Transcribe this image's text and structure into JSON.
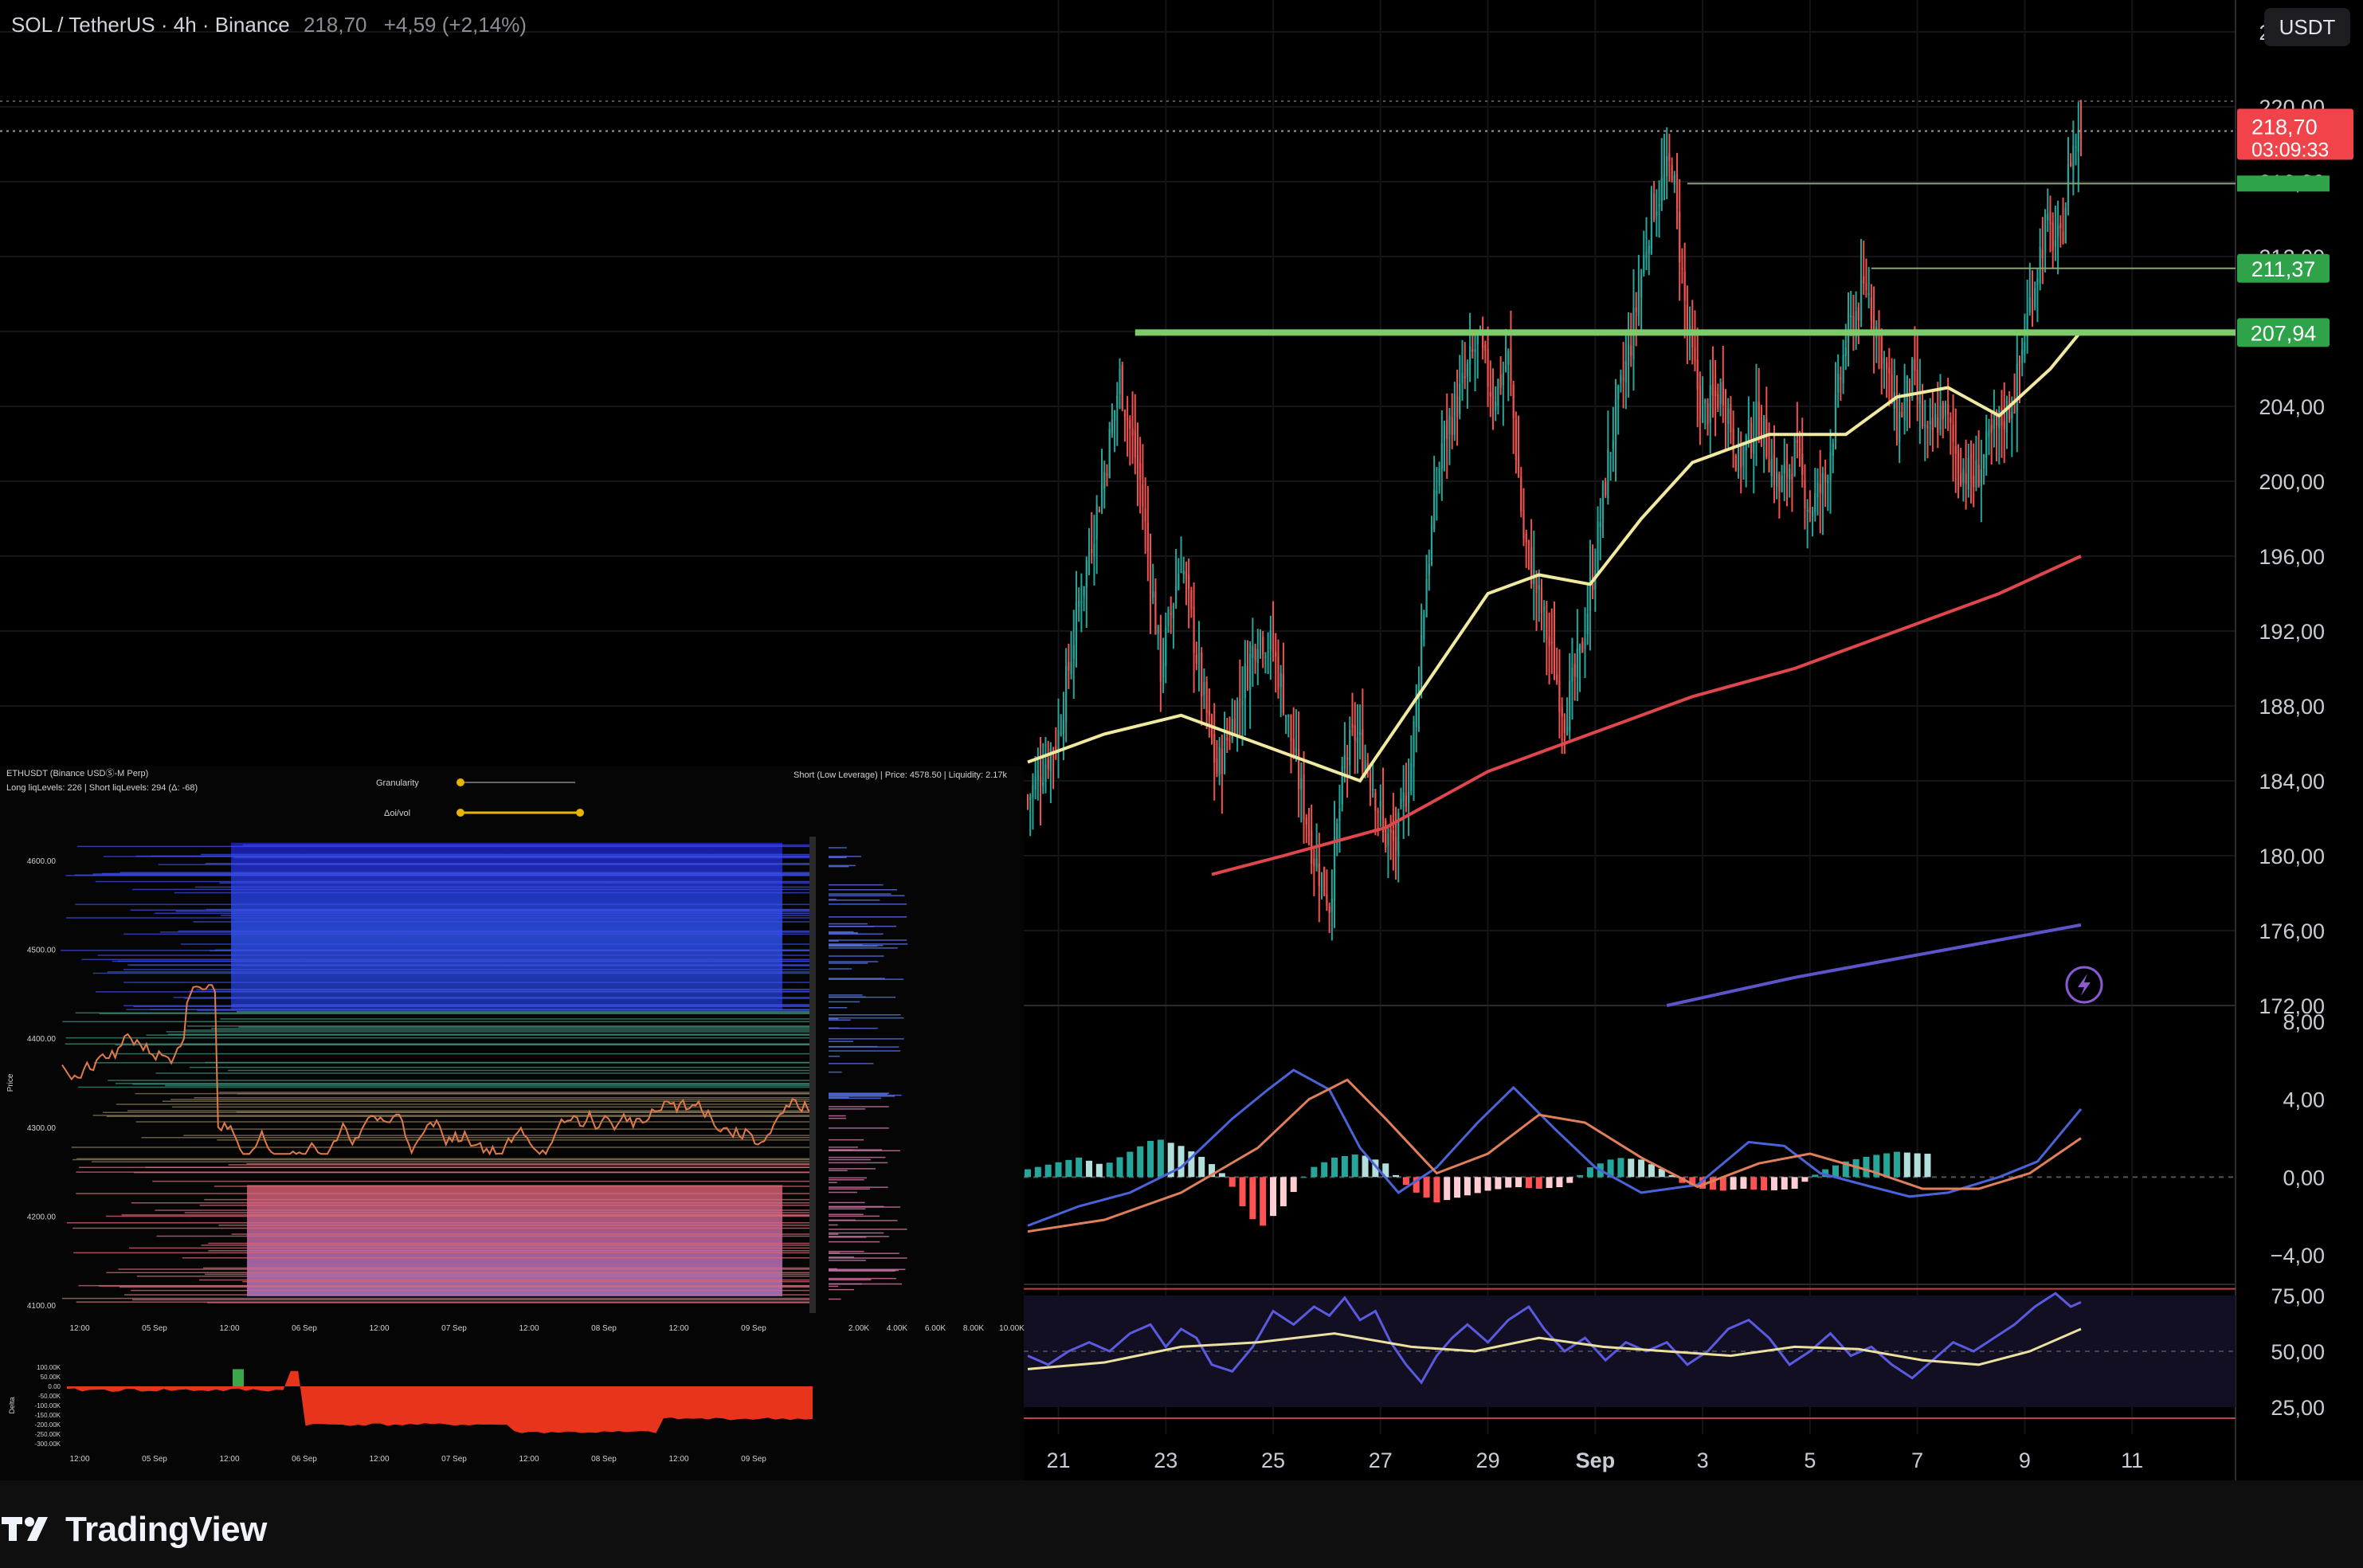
{
  "header": {
    "symbol": "SOL / TetherUS · 4h · Binance",
    "price": "218,70",
    "change": "+4,59 (+2,14%)"
  },
  "currency_button": "USDT",
  "brand": {
    "name": "TradingView",
    "icon": "tradingview-logo-icon"
  },
  "colors": {
    "up": "#26a69a",
    "down": "#ef5350",
    "ma_fast": "#f0eaa0",
    "ma_slow": "#e0474c",
    "ma_long": "#5c54c9",
    "level": "#7ecb6a",
    "price_tag": "#f0434a"
  },
  "chart_data": [
    {
      "type": "candlestick",
      "name": "main-price-chart",
      "x_labels": [
        "21",
        "23",
        "25",
        "27",
        "29",
        "Sep",
        "3",
        "5",
        "7",
        "9",
        "11"
      ],
      "y_ticks": [
        "224,00",
        "220,00",
        "216,00",
        "212,00",
        "208,00",
        "204,00",
        "200,00",
        "196,00",
        "192,00",
        "188,00",
        "184,00",
        "180,00",
        "176,00",
        "172,00"
      ],
      "y_tick_values": [
        224,
        220,
        216,
        212,
        208,
        204,
        200,
        196,
        192,
        188,
        184,
        180,
        176,
        172
      ],
      "ylim": [
        172,
        224
      ],
      "last_price": {
        "value": 218.7,
        "label": "218,70",
        "countdown": "03:09:33"
      },
      "horizontal_levels": [
        {
          "value": 211.37,
          "label": "211,37"
        },
        {
          "value": 207.94,
          "label": "207,94"
        },
        {
          "value": 215.9,
          "label": ""
        }
      ],
      "close_path": [
        [
          0,
          183.0
        ],
        [
          12,
          186.5
        ],
        [
          20,
          193.5
        ],
        [
          30,
          200.5
        ],
        [
          36,
          205.5
        ],
        [
          44,
          200.0
        ],
        [
          52,
          190.0
        ],
        [
          60,
          196.0
        ],
        [
          68,
          189.0
        ],
        [
          74,
          184.5
        ],
        [
          82,
          188.0
        ],
        [
          90,
          192.0
        ],
        [
          96,
          191.0
        ],
        [
          100,
          188.5
        ],
        [
          106,
          184.0
        ],
        [
          112,
          180.0
        ],
        [
          118,
          177.5
        ],
        [
          124,
          185.0
        ],
        [
          128,
          186.5
        ],
        [
          134,
          184.5
        ],
        [
          140,
          181.0
        ],
        [
          144,
          180.5
        ],
        [
          150,
          185.0
        ],
        [
          156,
          195.0
        ],
        [
          162,
          202.0
        ],
        [
          170,
          205.0
        ],
        [
          176,
          207.5
        ],
        [
          182,
          204.5
        ],
        [
          188,
          206.5
        ],
        [
          194,
          197.0
        ],
        [
          202,
          192.5
        ],
        [
          210,
          187.5
        ],
        [
          216,
          190.5
        ],
        [
          222,
          196.0
        ],
        [
          228,
          202.0
        ],
        [
          236,
          207.5
        ],
        [
          244,
          214.5
        ],
        [
          252,
          217.0
        ],
        [
          258,
          208.0
        ],
        [
          264,
          203.5
        ],
        [
          272,
          205.0
        ],
        [
          278,
          201.0
        ],
        [
          286,
          203.5
        ],
        [
          294,
          199.5
        ],
        [
          300,
          201.5
        ],
        [
          306,
          198.5
        ],
        [
          312,
          200.0
        ],
        [
          320,
          207.5
        ],
        [
          328,
          210.5
        ],
        [
          334,
          207.0
        ],
        [
          340,
          203.0
        ],
        [
          346,
          205.5
        ],
        [
          352,
          202.0
        ],
        [
          358,
          204.0
        ],
        [
          364,
          201.0
        ],
        [
          370,
          200.0
        ],
        [
          378,
          202.5
        ],
        [
          386,
          204.5
        ],
        [
          392,
          209.5
        ],
        [
          398,
          213.5
        ],
        [
          404,
          212.5
        ],
        [
          408,
          217.5
        ],
        [
          412,
          218.7
        ]
      ],
      "ma_fast": [
        [
          0,
          185.0
        ],
        [
          30,
          186.5
        ],
        [
          60,
          187.5
        ],
        [
          110,
          185.0
        ],
        [
          130,
          184.0
        ],
        [
          150,
          188.0
        ],
        [
          180,
          194.0
        ],
        [
          200,
          195.0
        ],
        [
          220,
          194.5
        ],
        [
          240,
          198.0
        ],
        [
          260,
          201.0
        ],
        [
          290,
          202.5
        ],
        [
          320,
          202.5
        ],
        [
          340,
          204.5
        ],
        [
          360,
          205.0
        ],
        [
          380,
          203.5
        ],
        [
          400,
          206.0
        ],
        [
          412,
          208.0
        ]
      ],
      "ma_slow": [
        [
          72,
          179.0
        ],
        [
          100,
          180.0
        ],
        [
          140,
          181.5
        ],
        [
          180,
          184.5
        ],
        [
          220,
          186.5
        ],
        [
          260,
          188.5
        ],
        [
          300,
          190.0
        ],
        [
          340,
          192.0
        ],
        [
          380,
          194.0
        ],
        [
          412,
          196.0
        ]
      ],
      "ma_long": [
        [
          250,
          172.0
        ],
        [
          300,
          173.5
        ],
        [
          360,
          175.0
        ],
        [
          412,
          176.3
        ]
      ]
    },
    {
      "type": "line",
      "name": "macd-panel",
      "y_ticks": [
        "8,00",
        "4,00",
        "0,00",
        "−4,00"
      ],
      "y_tick_values": [
        8,
        4,
        0,
        -4
      ],
      "ylim": [
        -4,
        8
      ],
      "histogram": [
        [
          0,
          0.4
        ],
        [
          10,
          0.7
        ],
        [
          20,
          1.0
        ],
        [
          30,
          0.6
        ],
        [
          40,
          1.3
        ],
        [
          50,
          2.0
        ],
        [
          60,
          1.6
        ],
        [
          70,
          0.9
        ],
        [
          76,
          0.2
        ],
        [
          80,
          -0.5
        ],
        [
          86,
          -2.0
        ],
        [
          92,
          -2.5
        ],
        [
          100,
          -1.5
        ],
        [
          106,
          -0.4
        ],
        [
          110,
          0.4
        ],
        [
          120,
          1.0
        ],
        [
          130,
          1.2
        ],
        [
          140,
          0.7
        ],
        [
          146,
          -0.2
        ],
        [
          152,
          -0.8
        ],
        [
          160,
          -1.3
        ],
        [
          170,
          -1.0
        ],
        [
          180,
          -0.7
        ],
        [
          190,
          -0.5
        ],
        [
          200,
          -0.6
        ],
        [
          210,
          -0.5
        ],
        [
          220,
          0.5
        ],
        [
          230,
          1.0
        ],
        [
          240,
          0.9
        ],
        [
          250,
          0.3
        ],
        [
          256,
          -0.3
        ],
        [
          264,
          -0.6
        ],
        [
          272,
          -0.7
        ],
        [
          280,
          -0.6
        ],
        [
          290,
          -0.7
        ],
        [
          300,
          -0.6
        ],
        [
          310,
          0.3
        ],
        [
          320,
          0.8
        ],
        [
          330,
          1.1
        ],
        [
          340,
          1.3
        ],
        [
          350,
          1.2
        ]
      ],
      "macd": [
        [
          0,
          -2.5
        ],
        [
          20,
          -1.5
        ],
        [
          40,
          -0.8
        ],
        [
          60,
          0.5
        ],
        [
          80,
          3.0
        ],
        [
          94,
          4.5
        ],
        [
          104,
          5.5
        ],
        [
          118,
          4.5
        ],
        [
          130,
          1.5
        ],
        [
          145,
          -0.8
        ],
        [
          160,
          0.5
        ],
        [
          176,
          2.8
        ],
        [
          190,
          4.6
        ],
        [
          206,
          2.5
        ],
        [
          222,
          0.5
        ],
        [
          240,
          -0.8
        ],
        [
          262,
          -0.4
        ],
        [
          282,
          1.8
        ],
        [
          296,
          1.6
        ],
        [
          310,
          0.2
        ],
        [
          330,
          -0.5
        ],
        [
          345,
          -1.0
        ],
        [
          360,
          -0.8
        ],
        [
          380,
          0.0
        ],
        [
          395,
          0.8
        ],
        [
          412,
          3.5
        ]
      ],
      "signal": [
        [
          0,
          -2.8
        ],
        [
          30,
          -2.2
        ],
        [
          60,
          -0.8
        ],
        [
          90,
          1.5
        ],
        [
          110,
          4.0
        ],
        [
          125,
          5.0
        ],
        [
          140,
          3.0
        ],
        [
          160,
          0.2
        ],
        [
          180,
          1.2
        ],
        [
          200,
          3.2
        ],
        [
          218,
          2.8
        ],
        [
          240,
          1.0
        ],
        [
          262,
          -0.5
        ],
        [
          286,
          0.7
        ],
        [
          306,
          1.2
        ],
        [
          330,
          0.3
        ],
        [
          350,
          -0.6
        ],
        [
          372,
          -0.6
        ],
        [
          392,
          0.2
        ],
        [
          412,
          2.0
        ]
      ]
    },
    {
      "type": "line",
      "name": "rsi-panel",
      "y_ticks": [
        "75,00",
        "50,00",
        "25,00"
      ],
      "y_tick_values": [
        75,
        50,
        25
      ],
      "ylim": [
        15,
        85
      ],
      "rsi": [
        [
          0,
          48
        ],
        [
          8,
          44
        ],
        [
          16,
          50
        ],
        [
          24,
          54
        ],
        [
          32,
          50
        ],
        [
          40,
          58
        ],
        [
          48,
          62
        ],
        [
          54,
          52
        ],
        [
          60,
          60
        ],
        [
          66,
          56
        ],
        [
          72,
          44
        ],
        [
          80,
          41
        ],
        [
          88,
          52
        ],
        [
          96,
          68
        ],
        [
          104,
          62
        ],
        [
          112,
          70
        ],
        [
          118,
          66
        ],
        [
          124,
          74
        ],
        [
          130,
          64
        ],
        [
          136,
          68
        ],
        [
          142,
          54
        ],
        [
          148,
          44
        ],
        [
          154,
          36
        ],
        [
          160,
          48
        ],
        [
          166,
          56
        ],
        [
          172,
          62
        ],
        [
          180,
          54
        ],
        [
          188,
          64
        ],
        [
          196,
          70
        ],
        [
          202,
          60
        ],
        [
          210,
          50
        ],
        [
          218,
          56
        ],
        [
          226,
          46
        ],
        [
          234,
          54
        ],
        [
          242,
          50
        ],
        [
          250,
          54
        ],
        [
          258,
          44
        ],
        [
          266,
          50
        ],
        [
          274,
          60
        ],
        [
          282,
          64
        ],
        [
          290,
          56
        ],
        [
          298,
          44
        ],
        [
          306,
          50
        ],
        [
          314,
          58
        ],
        [
          322,
          48
        ],
        [
          330,
          52
        ],
        [
          338,
          44
        ],
        [
          346,
          38
        ],
        [
          354,
          46
        ],
        [
          362,
          54
        ],
        [
          370,
          50
        ],
        [
          378,
          56
        ],
        [
          386,
          62
        ],
        [
          394,
          70
        ],
        [
          402,
          76
        ],
        [
          408,
          70
        ],
        [
          412,
          72
        ]
      ],
      "rsi_ma": [
        [
          0,
          42
        ],
        [
          30,
          45
        ],
        [
          60,
          52
        ],
        [
          90,
          54
        ],
        [
          120,
          58
        ],
        [
          150,
          52
        ],
        [
          175,
          50
        ],
        [
          200,
          56
        ],
        [
          225,
          52
        ],
        [
          250,
          50
        ],
        [
          275,
          48
        ],
        [
          300,
          52
        ],
        [
          325,
          51
        ],
        [
          350,
          46
        ],
        [
          372,
          44
        ],
        [
          392,
          50
        ],
        [
          412,
          60
        ]
      ]
    },
    {
      "type": "heatmap",
      "name": "liquidation-heatmap-inset",
      "title": "ETHUSDT (Binance USDⓈ-M Perp)",
      "subtitle": "Long liqLevels: 226 | Short liqLevels: 294 (Δ: -68)",
      "controls": [
        "Granularity",
        "Δoi/vol"
      ],
      "tooltip": "Short (Low Leverage) | Price: 4578.50 | Liquidity: 2.17k",
      "ylabel": "Price",
      "y_ticks": [
        "4600.00",
        "4500.00",
        "4400.00",
        "4300.00",
        "4200.00",
        "4100.00"
      ],
      "x_ticks": [
        "12:00",
        "05 Sep",
        "12:00",
        "06 Sep",
        "12:00",
        "07 Sep",
        "12:00",
        "08 Sep",
        "12:00",
        "09 Sep"
      ],
      "profile_x_ticks": [
        "2.00K",
        "4.00K",
        "6.00K",
        "8.00K",
        "10.00K"
      ],
      "delta_ylabel": "Delta",
      "delta_y_ticks": [
        "100.00K",
        "50.00K",
        "0.00",
        "-50.00K",
        "-100.00K",
        "-150.00K",
        "-200.00K",
        "-250.00K",
        "-300.00K"
      ],
      "delta_x_ticks": [
        "12:00",
        "05 Sep",
        "12:00",
        "06 Sep",
        "12:00",
        "07 Sep",
        "12:00",
        "08 Sep",
        "12:00",
        "09 Sep"
      ]
    }
  ]
}
